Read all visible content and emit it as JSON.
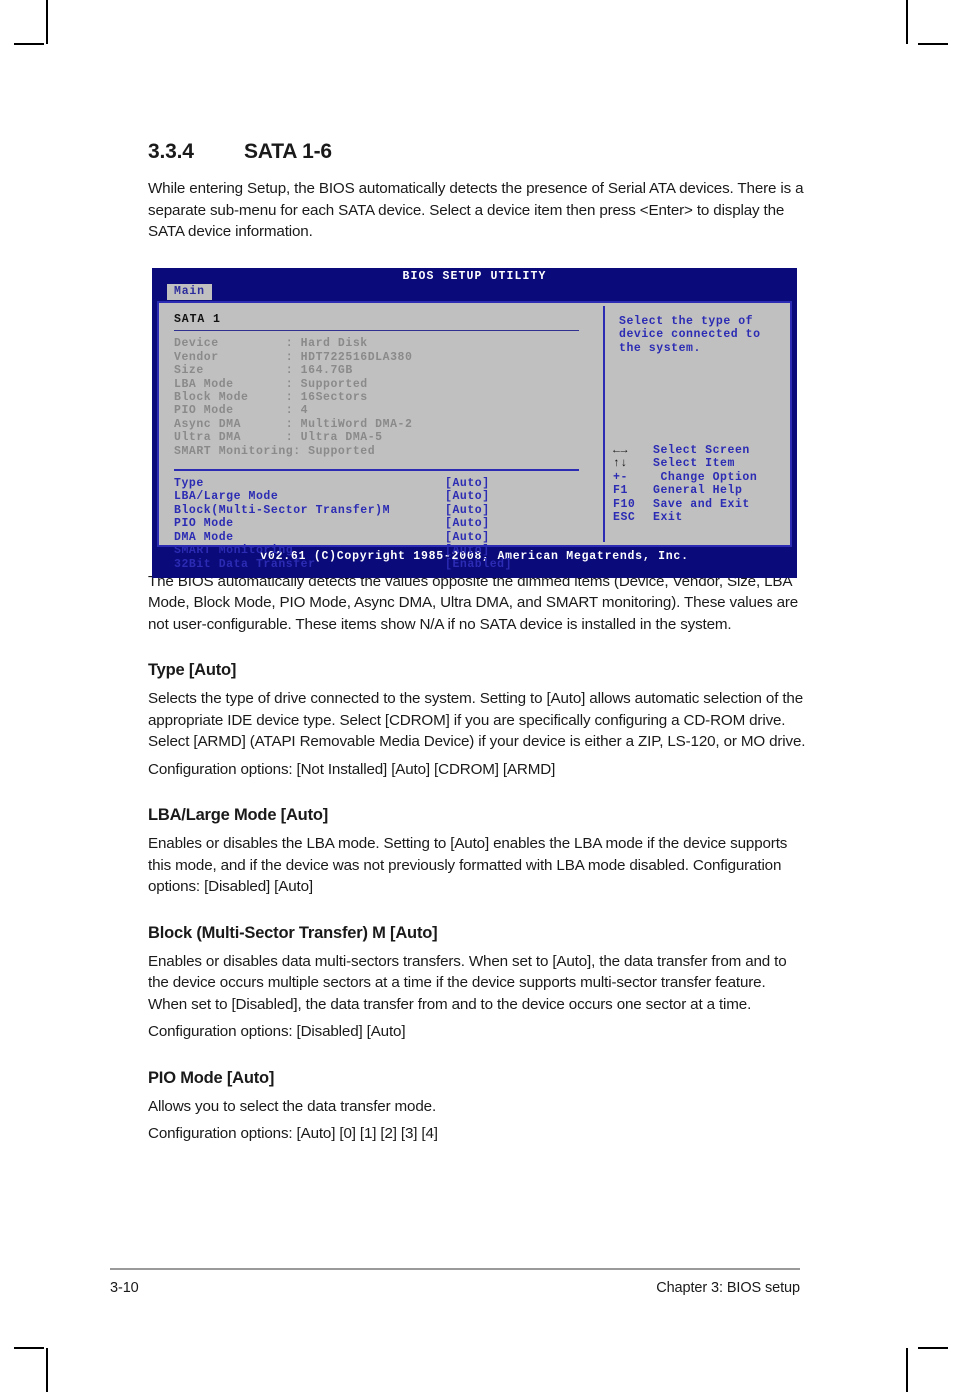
{
  "section": {
    "number": "3.3.4",
    "title": "SATA 1-6",
    "intro": "While entering Setup, the BIOS automatically detects the presence of Serial ATA devices. There is a separate sub-menu for each SATA device. Select a device item then press <Enter> to display the SATA device information.",
    "after_figure": "The BIOS automatically detects the values opposite the dimmed items (Device, Vendor, Size, LBA Mode, Block Mode, PIO Mode, Async DMA, Ultra DMA, and SMART monitoring). These values are not user-configurable. These items show N/A if no SATA device is installed in the system."
  },
  "bios": {
    "title": "BIOS SETUP UTILITY",
    "tab": "Main",
    "device_title": "SATA 1",
    "info_rows": [
      {
        "label": "Device",
        "sep": ":",
        "value": "Hard Disk"
      },
      {
        "label": "Vendor",
        "sep": ":",
        "value": "HDT722516DLA380"
      },
      {
        "label": "Size",
        "sep": ":",
        "value": "164.7GB"
      },
      {
        "label": "LBA Mode",
        "sep": ":",
        "value": "Supported"
      },
      {
        "label": "Block Mode",
        "sep": ":",
        "value": "16Sectors"
      },
      {
        "label": "PIO Mode",
        "sep": ":",
        "value": "4"
      },
      {
        "label": "Async DMA",
        "sep": ":",
        "value": "MultiWord DMA-2"
      },
      {
        "label": "Ultra DMA",
        "sep": ":",
        "value": "Ultra DMA-5"
      },
      {
        "label": "SMART Monitoring",
        "sep": ":",
        "value": "Supported"
      }
    ],
    "info_lines": [
      "Device         : Hard Disk",
      "Vendor         : HDT722516DLA380",
      "Size           : 164.7GB",
      "LBA Mode       : Supported",
      "Block Mode     : 16Sectors",
      "PIO Mode       : 4",
      "Async DMA      : MultiWord DMA-2",
      "Ultra DMA      : Ultra DMA-5",
      "SMART Monitoring: Supported"
    ],
    "config_rows": [
      {
        "label": "Type",
        "value": "[Auto]"
      },
      {
        "label": "LBA/Large Mode",
        "value": "[Auto]"
      },
      {
        "label": "Block(Multi-Sector Transfer)M",
        "value": "[Auto]"
      },
      {
        "label": "PIO Mode",
        "value": "[Auto]"
      },
      {
        "label": "DMA Mode",
        "value": "[Auto]"
      },
      {
        "label": "SMART Monitoring",
        "value": "[Auto]"
      },
      {
        "label": "32Bit Data Transfer",
        "value": "[Enabled]"
      }
    ],
    "help_lines": [
      "Select the type of",
      "device connected to",
      "the system."
    ],
    "keys": [
      {
        "glyph": "←→",
        "desc": "Select Screen",
        "glyph_blue": false
      },
      {
        "glyph": "↑↓",
        "desc": "Select Item",
        "glyph_blue": false
      },
      {
        "glyph": "+-",
        "desc": " Change Option",
        "glyph_blue": true
      },
      {
        "glyph": "F1",
        "desc": "General Help",
        "glyph_blue": true
      },
      {
        "glyph": "F10",
        "desc": "Save and Exit",
        "glyph_blue": true
      },
      {
        "glyph": "ESC",
        "desc": "Exit",
        "glyph_blue": true
      }
    ],
    "footer": "v02.61 (C)Copyright 1985-2008, American Megatrends, Inc.",
    "colors": {
      "screen_blue": "#0a0a7a",
      "panel_gray": "#c0c0c0",
      "accent_blue": "#2b2bb4",
      "dimmed_gray": "#8a8a8a"
    }
  },
  "items": [
    {
      "heading": "Type [Auto]",
      "paragraphs": [
        "Selects the type of drive connected to the system. Setting to [Auto] allows automatic selection of the appropriate IDE device type. Select [CDROM] if you are specifically configuring a CD-ROM drive. Select [ARMD] (ATAPI Removable Media Device) if your device is either a ZIP, LS-120, or MO drive.",
        "Configuration options: [Not Installed] [Auto] [CDROM] [ARMD]"
      ]
    },
    {
      "heading": "LBA/Large Mode [Auto]",
      "paragraphs": [
        "Enables or disables the LBA mode. Setting to [Auto] enables the LBA mode if the device supports this mode, and if the device was not previously formatted with LBA mode disabled. Configuration options: [Disabled] [Auto]"
      ]
    },
    {
      "heading": "Block (Multi-Sector Transfer) M [Auto]",
      "paragraphs": [
        "Enables or disables data multi-sectors transfers. When set to [Auto], the data transfer from and to the device occurs multiple sectors at a time if the device supports multi-sector transfer feature. When set to [Disabled], the data transfer from and to the device occurs one sector at a time.",
        "Configuration options: [Disabled] [Auto]"
      ]
    },
    {
      "heading": "PIO Mode [Auto]",
      "paragraphs": [
        "Allows you to select the data transfer mode.",
        "Configuration options: [Auto] [0] [1] [2] [3] [4]"
      ]
    }
  ],
  "footer": {
    "page_number": "3-10",
    "chapter": "Chapter 3: BIOS setup"
  }
}
